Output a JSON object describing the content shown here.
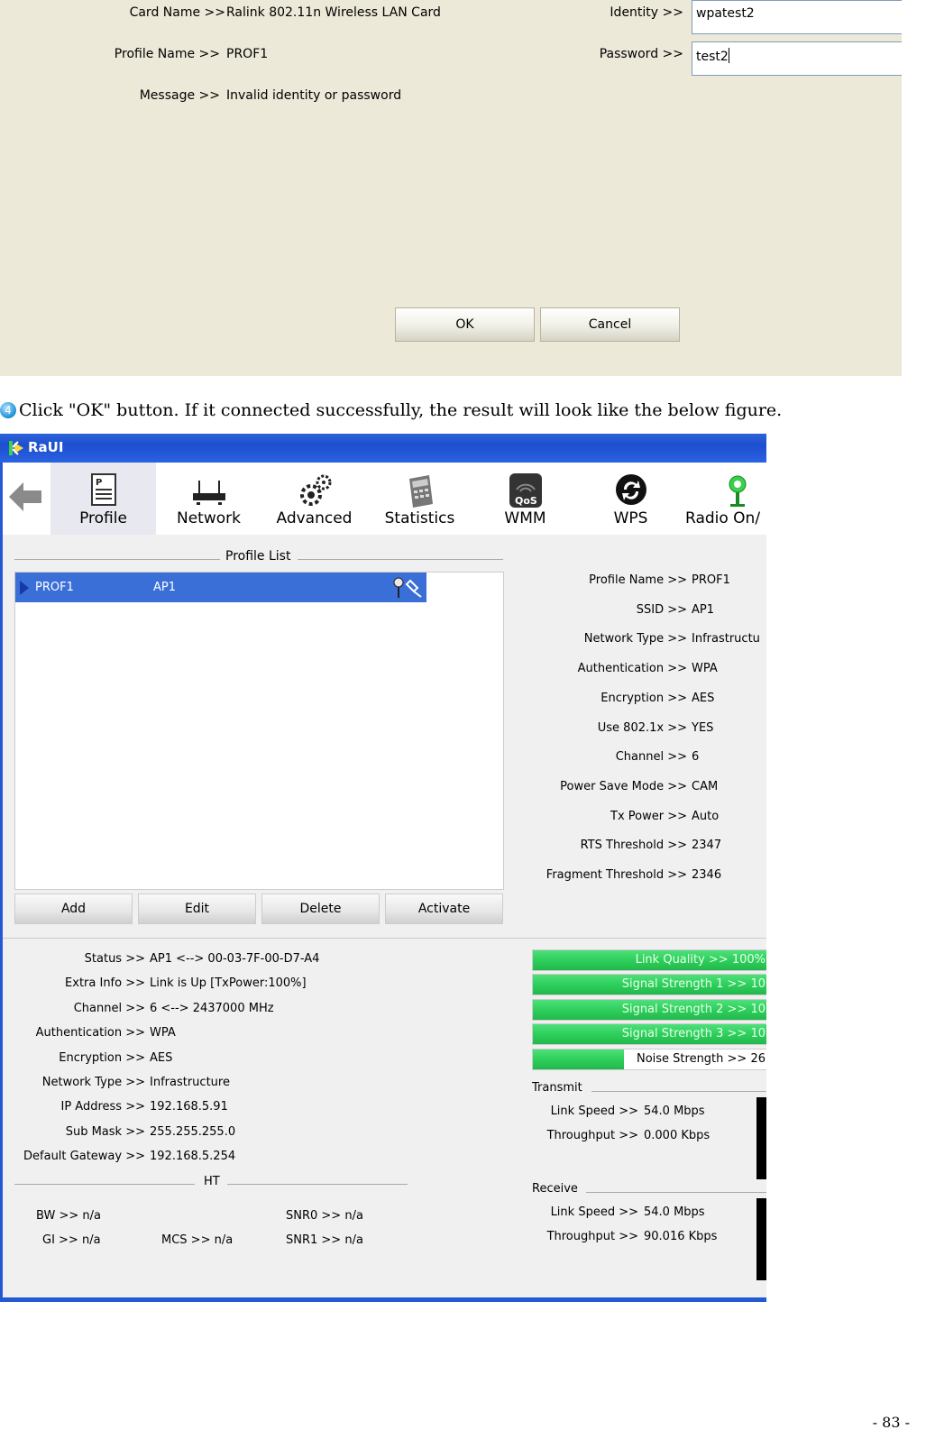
{
  "dialog": {
    "card_name_label": "Card Name >>",
    "card_name_value": "Ralink 802.11n Wireless LAN Card",
    "profile_name_label": "Profile Name >>",
    "profile_name_value": "PROF1",
    "message_label": "Message >>",
    "message_value": "Invalid identity or password",
    "identity_label": "Identity >>",
    "identity_value": "wpatest2",
    "password_label": "Password >>",
    "password_value": "test2",
    "ok_label": "OK",
    "cancel_label": "Cancel"
  },
  "caption": {
    "step_number": "4",
    "text": "Click \"OK\" button. If it connected successfully, the result will look like the below figure."
  },
  "window": {
    "title": "RaUI",
    "toolbar": [
      {
        "label": "Profile",
        "icon": "profile-icon"
      },
      {
        "label": "Network",
        "icon": "network-icon"
      },
      {
        "label": "Advanced",
        "icon": "gears-icon"
      },
      {
        "label": "Statistics",
        "icon": "calculator-icon"
      },
      {
        "label": "WMM",
        "icon": "qos-icon"
      },
      {
        "label": "WPS",
        "icon": "wps-icon"
      },
      {
        "label": "Radio On/",
        "icon": "radio-antenna-icon"
      }
    ],
    "profile_list": {
      "title": "Profile List",
      "rows": [
        {
          "profile": "PROF1",
          "ssid": "AP1"
        }
      ],
      "buttons": [
        "Add",
        "Edit",
        "Delete",
        "Activate"
      ]
    },
    "profile_details": [
      {
        "label": "Profile Name >>",
        "value": "PROF1"
      },
      {
        "label": "SSID >>",
        "value": "AP1"
      },
      {
        "label": "Network Type >>",
        "value": "Infrastructu"
      },
      {
        "label": "Authentication >>",
        "value": "WPA"
      },
      {
        "label": "Encryption >>",
        "value": "AES"
      },
      {
        "label": "Use 802.1x >>",
        "value": "YES"
      },
      {
        "label": "Channel >>",
        "value": "6"
      },
      {
        "label": "Power Save Mode >>",
        "value": "CAM"
      },
      {
        "label": "Tx Power >>",
        "value": "Auto"
      },
      {
        "label": "RTS Threshold >>",
        "value": "2347"
      },
      {
        "label": "Fragment Threshold >>",
        "value": "2346"
      }
    ],
    "status": [
      {
        "label": "Status >>",
        "value": "AP1 <--> 00-03-7F-00-D7-A4"
      },
      {
        "label": "Extra Info >>",
        "value": "Link is Up [TxPower:100%]"
      },
      {
        "label": "Channel >>",
        "value": "6 <--> 2437000 MHz"
      },
      {
        "label": "Authentication >>",
        "value": "WPA"
      },
      {
        "label": "Encryption >>",
        "value": "AES"
      },
      {
        "label": "Network Type >>",
        "value": "Infrastructure"
      },
      {
        "label": "IP Address >>",
        "value": "192.168.5.91"
      },
      {
        "label": "Sub Mask >>",
        "value": "255.255.255.0"
      },
      {
        "label": "Default Gateway >>",
        "value": "192.168.5.254"
      }
    ],
    "ht": {
      "title": "HT",
      "bw": "BW >> n/a",
      "gi": "GI >> n/a",
      "mcs": "MCS >> n/a",
      "snr0": "SNR0 >> n/a",
      "snr1": "SNR1 >> n/a"
    },
    "signal_bars": [
      {
        "label": "Link Quality >> 100%",
        "level": 1.0
      },
      {
        "label": "Signal Strength 1 >> 10",
        "level": 1.0
      },
      {
        "label": "Signal Strength 2 >> 10",
        "level": 1.0
      },
      {
        "label": "Signal Strength 3 >> 10",
        "level": 1.0
      },
      {
        "label": "Noise Strength >> 26",
        "level": 0.39
      }
    ],
    "transmit": {
      "title": "Transmit",
      "link_speed_label": "Link Speed >>",
      "link_speed_value": "54.0 Mbps",
      "throughput_label": "Throughput >>",
      "throughput_value": "0.000 Kbps"
    },
    "receive": {
      "title": "Receive",
      "link_speed_label": "Link Speed >>",
      "link_speed_value": "54.0 Mbps",
      "throughput_label": "Throughput >>",
      "throughput_value": "90.016 Kbps"
    }
  },
  "page_number": "- 83 -",
  "colors": {
    "dialog_bg": "#ece9d8",
    "title_blue": "#2459d6",
    "selection_blue": "#3a6fd8",
    "bar_green": "#2ecf5c"
  }
}
